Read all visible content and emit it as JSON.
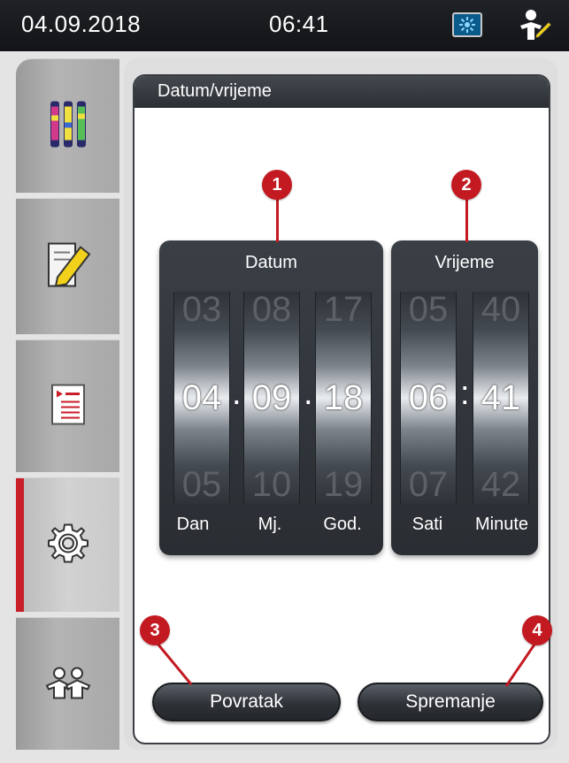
{
  "status_bar": {
    "date": "04.09.2018",
    "time": "06:41",
    "icons": [
      "network-icon",
      "user-icon"
    ]
  },
  "sidebar": {
    "items": [
      {
        "name": "reagents",
        "icon": "reagent-bottles-icon"
      },
      {
        "name": "edit",
        "icon": "pencil-note-icon"
      },
      {
        "name": "protocols",
        "icon": "list-document-icon"
      },
      {
        "name": "settings",
        "icon": "gear-icon",
        "active": true
      },
      {
        "name": "user",
        "icon": "user-switch-icon"
      }
    ],
    "active_color": "#c81e28"
  },
  "panel": {
    "title": "Datum/vrijeme"
  },
  "date_picker": {
    "title": "Datum",
    "columns": [
      {
        "label": "Dan",
        "prev": "03",
        "value": "04",
        "next": "05"
      },
      {
        "label": "Mj.",
        "prev": "08",
        "value": "09",
        "next": "10"
      },
      {
        "label": "God.",
        "prev": "17",
        "value": "18",
        "next": "19"
      }
    ],
    "separator": "."
  },
  "time_picker": {
    "title": "Vrijeme",
    "columns": [
      {
        "label": "Sati",
        "prev": "05",
        "value": "06",
        "next": "07"
      },
      {
        "label": "Minute",
        "prev": "40",
        "value": "41",
        "next": "42"
      }
    ],
    "separator": ":"
  },
  "buttons": {
    "back": "Povratak",
    "save": "Spremanje"
  },
  "callouts": [
    "1",
    "2",
    "3",
    "4"
  ],
  "colors": {
    "callout": "#c31a22",
    "statusbar": "#1a1d21"
  }
}
